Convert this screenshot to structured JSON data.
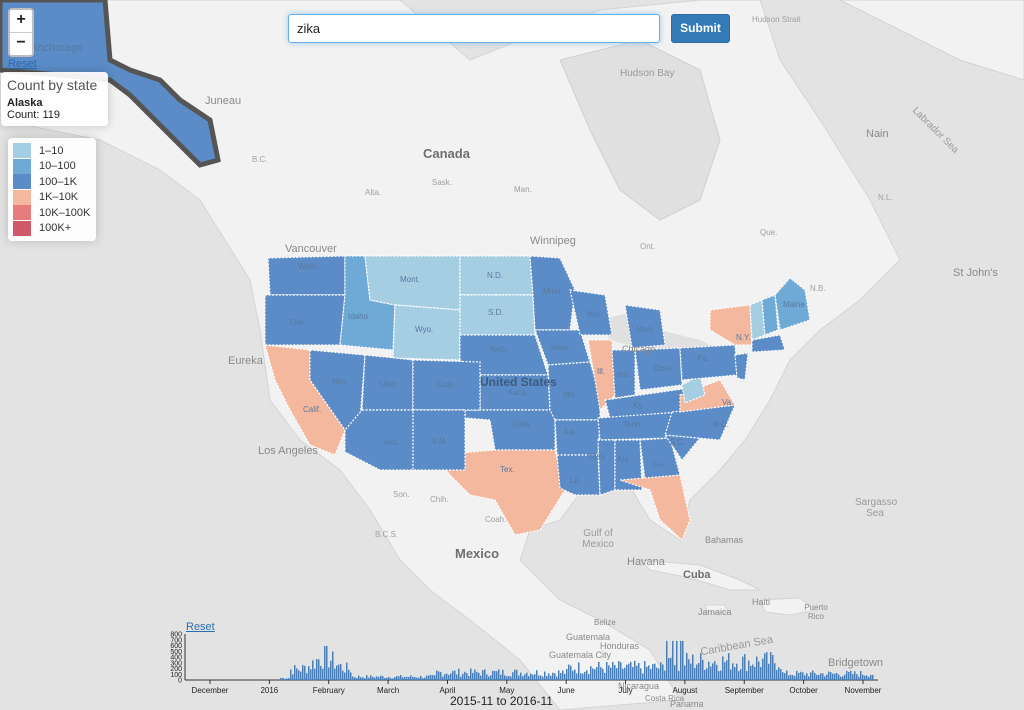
{
  "search": {
    "value": "zika",
    "submit_label": "Submit"
  },
  "zoom": {
    "in": "+",
    "out": "−"
  },
  "reset_top": "Reset",
  "info": {
    "title": "Count by state",
    "state": "Alaska",
    "count": "Count: 119"
  },
  "legend": [
    {
      "label": "1–10",
      "color": "#a6cee3"
    },
    {
      "label": "10–100",
      "color": "#6fa9d6"
    },
    {
      "label": "100–1K",
      "color": "#5b8cc7"
    },
    {
      "label": "1K–10K",
      "color": "#f4b89e"
    },
    {
      "label": "10K–100K",
      "color": "#e67d7d"
    },
    {
      "label": "100K+",
      "color": "#cf5b69"
    }
  ],
  "map_labels": {
    "anchorage": "Anchorage",
    "juneau": "Juneau",
    "canada": "Canada",
    "vancouver": "Vancouver",
    "winnipeg": "Winnipeg",
    "hudson_bay": "Hudson Bay",
    "hudson_strait": "Hudson Strait",
    "labrador_sea": "Labrador Sea",
    "nain": "Nain",
    "st_johns": "St John's",
    "eureka": "Eureka",
    "los_angeles": "Los Angeles",
    "united_states": "United States",
    "mexico": "Mexico",
    "gulf_of_mexico": "Gulf of Mexico",
    "sargasso_sea": "Sargasso Sea",
    "bahamas": "Bahamas",
    "havana": "Havana",
    "cuba": "Cuba",
    "jamaica": "Jamaica",
    "haiti": "Haiti",
    "puerto_rico": "Puerto Rico",
    "caribbean_sea": "Caribbean Sea",
    "bridgetown": "Bridgetown",
    "guatemala": "Guatemala",
    "guatemala_city": "Guatemala City",
    "honduras": "Honduras",
    "nicaragua": "Nicaragua",
    "costa_rica": "Costa Rica",
    "panama": "Panama",
    "belize": "Belize",
    "chicago": "Chicago",
    "bc": "B.C.",
    "ont": "Ont.",
    "que": "Que.",
    "nl": "N.L.",
    "nb": "N.B.",
    "sask": "Sask.",
    "alta": "Alta.",
    "man": "Man.",
    "son": "Son.",
    "chih": "Chih.",
    "coah": "Coah.",
    "bc_mx": "B.C.S."
  },
  "state_labels": {
    "wash": "Wash.",
    "ore": "Ore.",
    "idaho": "Idaho",
    "mont": "Mont.",
    "wyo": "Wyo.",
    "nd": "N.D.",
    "sd": "S.D.",
    "nebr": "Nebr.",
    "kans": "Kans.",
    "okla": "Okla.",
    "tex": "Tex.",
    "calif": "Calif.",
    "nev": "Nev.",
    "utah": "Utah",
    "colo": "Colo.",
    "ariz": "Ariz.",
    "nm": "N.M.",
    "minn": "Minn.",
    "iowa": "Iowa",
    "mo": "Mo.",
    "ark": "Ark.",
    "la": "La.",
    "wis": "Wis.",
    "ill": "Ill.",
    "mich": "Mich.",
    "ind": "Ind.",
    "ohio": "Ohio",
    "ky": "Ky.",
    "tenn": "Tenn.",
    "miss": "Miss.",
    "ala": "Ala.",
    "ga": "Ga.",
    "fla": "Fla.",
    "sc": "S.C.",
    "nc": "N.C.",
    "va": "Va.",
    "pa": "Pa.",
    "ny": "N.Y.",
    "maine": "Maine"
  },
  "histogram": {
    "reset_label": "Reset",
    "range_label": "2015-11 to 2016-11",
    "y_ticks": [
      "800",
      "700",
      "600",
      "500",
      "400",
      "300",
      "200",
      "100",
      "0"
    ],
    "x_ticks": [
      "December",
      "2016",
      "February",
      "March",
      "April",
      "May",
      "June",
      "July",
      "August",
      "September",
      "October",
      "November"
    ]
  },
  "colors": {
    "selected_outline": "#555555",
    "accent": "#337ab7",
    "land": "#f2f2f2",
    "water": "#e0e0e0"
  }
}
